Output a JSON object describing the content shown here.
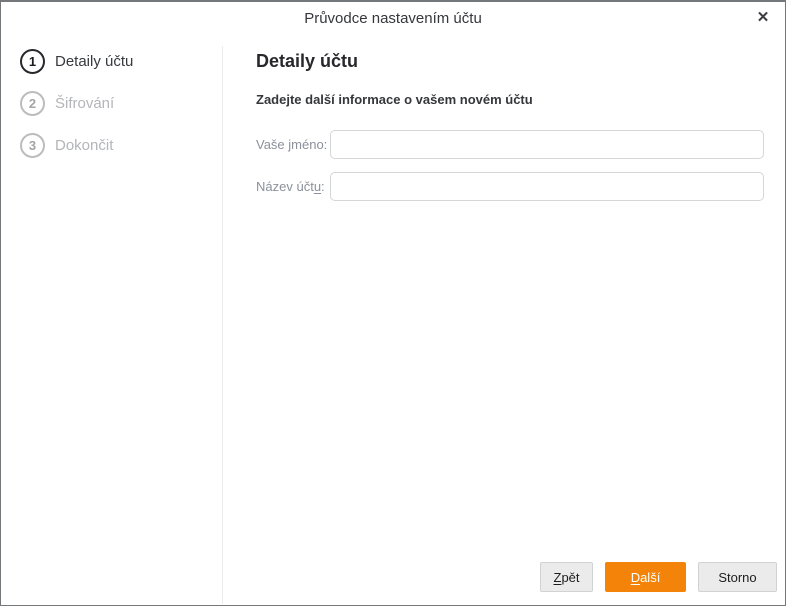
{
  "window": {
    "title": "Průvodce nastavením účtu",
    "close_icon": "✕"
  },
  "steps": [
    {
      "number": "1",
      "label": "Detaily účtu",
      "state": "active"
    },
    {
      "number": "2",
      "label": "Šifrování",
      "state": "inactive"
    },
    {
      "number": "3",
      "label": "Dokončit",
      "state": "inactive"
    }
  ],
  "content": {
    "heading": "Detaily účtu",
    "description": "Zadejte další informace o vašem novém účtu",
    "fields": [
      {
        "label_pre": "Vaše jméno:",
        "label_key": "",
        "label_post": "",
        "value": "",
        "placeholder": ""
      },
      {
        "label_pre": "Název účt",
        "label_key": "u",
        "label_post": ":",
        "value": "",
        "placeholder": ""
      }
    ]
  },
  "buttons": {
    "back": {
      "key": "Z",
      "rest": "pět"
    },
    "next": {
      "key": "D",
      "rest": "alší"
    },
    "cancel": {
      "label": "Storno"
    }
  },
  "colors": {
    "accent_orange": "#f48409",
    "active_step": "#26282b",
    "inactive_step": "#bbbcbe",
    "dialog_border": "#74787b",
    "input_border": "#d5d6d8"
  }
}
